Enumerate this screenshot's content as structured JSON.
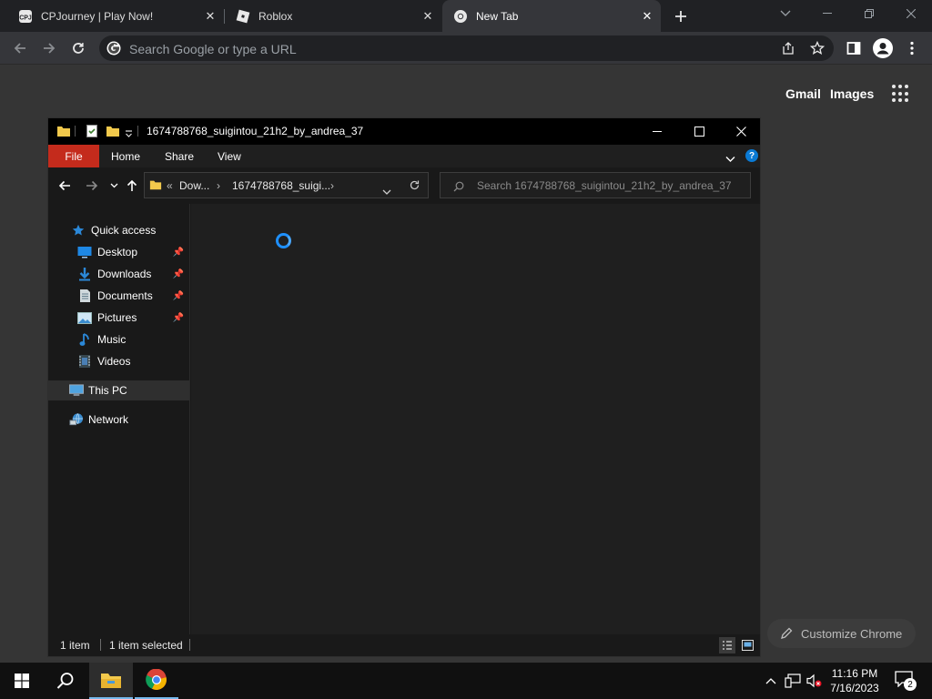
{
  "browser": {
    "tabs": [
      {
        "title": "CPJourney | Play Now!",
        "favicon": "cpjourney-icon",
        "active": false
      },
      {
        "title": "Roblox",
        "favicon": "roblox-icon",
        "active": false
      },
      {
        "title": "New Tab",
        "favicon": "chrome-icon",
        "active": true
      }
    ],
    "omnibox_placeholder": "Search Google or type a URL",
    "ntp_links": {
      "gmail": "Gmail",
      "images": "Images"
    },
    "customize_label": "Customize Chrome"
  },
  "explorer": {
    "title": "1674788768_suigintou_21h2_by_andrea_37",
    "ribbon_tabs": {
      "file": "File",
      "home": "Home",
      "share": "Share",
      "view": "View"
    },
    "help_label": "?",
    "address": {
      "prefix": "«",
      "seg1": "Dow...",
      "seg2": "1674788768_suigi..."
    },
    "search_placeholder": "Search 1674788768_suigintou_21h2_by_andrea_37",
    "nav": {
      "quick_access": "Quick access",
      "desktop": "Desktop",
      "downloads": "Downloads",
      "documents": "Documents",
      "pictures": "Pictures",
      "music": "Music",
      "videos": "Videos",
      "this_pc": "This PC",
      "network": "Network"
    },
    "status": {
      "count": "1 item",
      "selected": "1 item selected"
    }
  },
  "taskbar": {
    "time": "11:16 PM",
    "date": "7/16/2023",
    "notification_count": "2"
  },
  "colors": {
    "accent": "#0a7ad4",
    "file_tab": "#c42b1c",
    "folder": "#f2c94c"
  }
}
